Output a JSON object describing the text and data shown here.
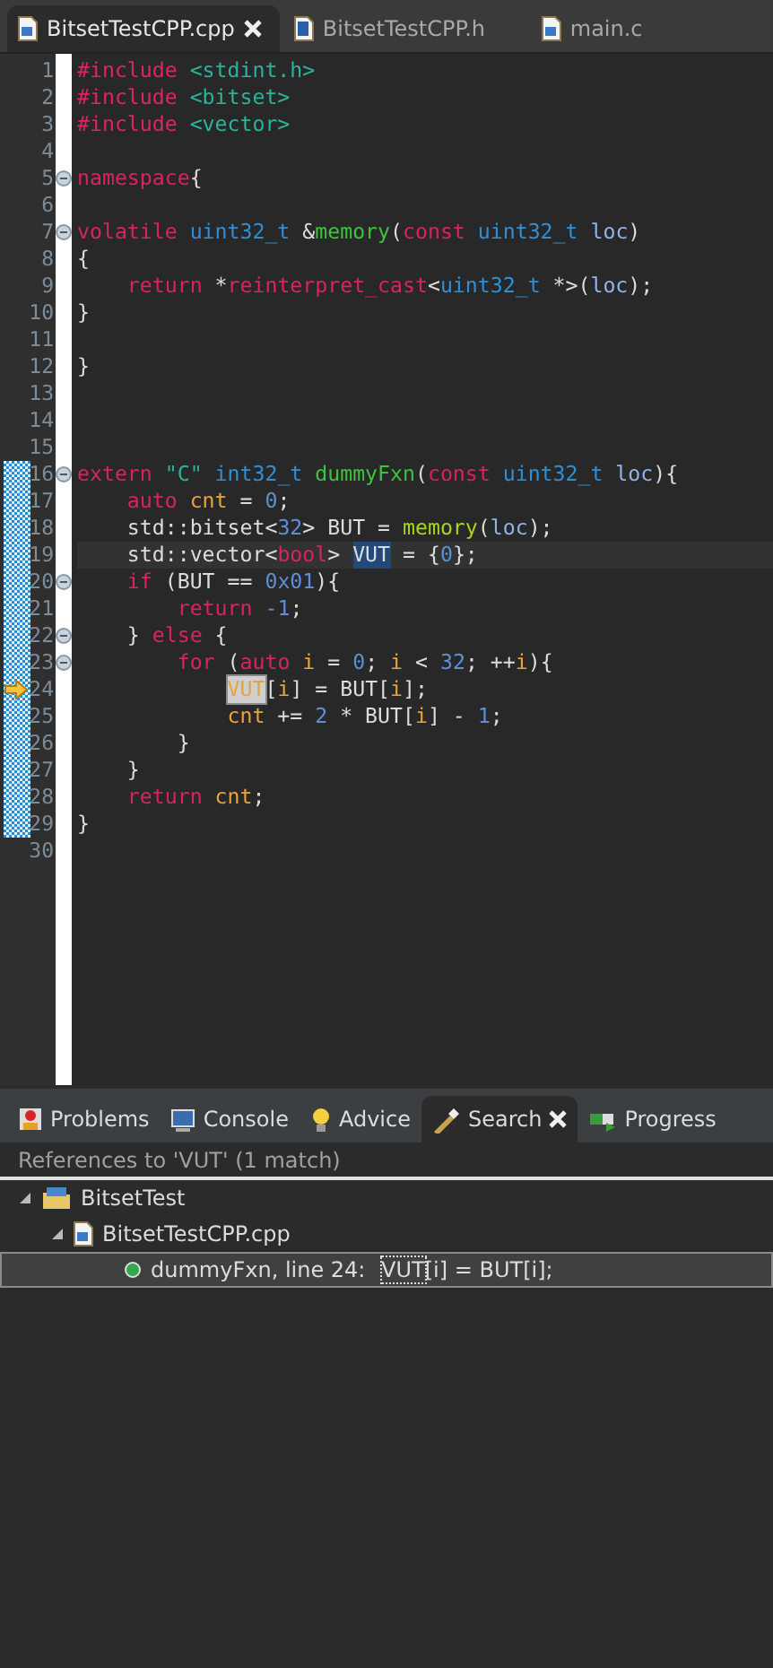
{
  "editor_tabs": [
    {
      "label": "BitsetTestCPP.cpp",
      "selected": true,
      "closable": true
    },
    {
      "label": "BitsetTestCPP.h",
      "selected": false,
      "closable": false
    },
    {
      "label": "main.c",
      "selected": false,
      "closable": false
    }
  ],
  "code_lines": [
    {
      "number": "1",
      "tokens": [
        {
          "text": "#include",
          "kind": "preproc"
        },
        {
          "text": " <stdint.h>",
          "kind": "header"
        }
      ]
    },
    {
      "number": "2",
      "tokens": [
        {
          "text": "#include",
          "kind": "preproc"
        },
        {
          "text": " <bitset>",
          "kind": "header"
        }
      ]
    },
    {
      "number": "3",
      "tokens": [
        {
          "text": "#include",
          "kind": "preproc"
        },
        {
          "text": " <vector>",
          "kind": "header"
        }
      ]
    },
    {
      "number": "4"
    },
    {
      "number": "5",
      "foldable": true,
      "tokens": [
        {
          "text": "namespace",
          "kind": "keyword"
        },
        {
          "text": "{",
          "kind": "plain"
        }
      ]
    },
    {
      "number": "6"
    },
    {
      "number": "7",
      "foldable": true,
      "tokens": [
        {
          "text": "volatile",
          "kind": "keyword"
        },
        {
          "text": " uint32_t",
          "kind": "type"
        },
        {
          "text": " &",
          "kind": "plain"
        },
        {
          "text": "memory",
          "kind": "function"
        },
        {
          "text": "(",
          "kind": "plain"
        },
        {
          "text": "const",
          "kind": "keyword"
        },
        {
          "text": " uint32_t",
          "kind": "type"
        },
        {
          "text": " loc",
          "kind": "param"
        },
        {
          "text": ")",
          "kind": "plain"
        }
      ]
    },
    {
      "number": "8",
      "tokens": [
        {
          "text": "{",
          "kind": "plain"
        }
      ]
    },
    {
      "number": "9",
      "tokens": [
        {
          "text": "    return",
          "kind": "keyword"
        },
        {
          "text": " *",
          "kind": "plain"
        },
        {
          "text": "reinterpret_cast",
          "kind": "keyword"
        },
        {
          "text": "<",
          "kind": "plain"
        },
        {
          "text": "uint32_t",
          "kind": "type"
        },
        {
          "text": " *>(",
          "kind": "plain"
        },
        {
          "text": "loc",
          "kind": "param"
        },
        {
          "text": ");",
          "kind": "plain"
        }
      ]
    },
    {
      "number": "10",
      "tokens": [
        {
          "text": "}",
          "kind": "plain"
        }
      ]
    },
    {
      "number": "11"
    },
    {
      "number": "12",
      "tokens": [
        {
          "text": "}",
          "kind": "plain"
        }
      ]
    },
    {
      "number": "13"
    },
    {
      "number": "14"
    },
    {
      "number": "15"
    },
    {
      "number": "16",
      "foldable": true,
      "changed": true,
      "tokens": [
        {
          "text": "extern",
          "kind": "keyword"
        },
        {
          "text": " \"C\"",
          "kind": "string"
        },
        {
          "text": " int32_t",
          "kind": "type"
        },
        {
          "text": " dummyFxn",
          "kind": "function"
        },
        {
          "text": "(",
          "kind": "plain"
        },
        {
          "text": "const",
          "kind": "keyword"
        },
        {
          "text": " uint32_t",
          "kind": "type"
        },
        {
          "text": " loc",
          "kind": "param"
        },
        {
          "text": "){",
          "kind": "plain"
        }
      ]
    },
    {
      "number": "17",
      "changed": true,
      "tokens": [
        {
          "text": "    auto",
          "kind": "keyword"
        },
        {
          "text": " cnt",
          "kind": "variable"
        },
        {
          "text": " = ",
          "kind": "plain"
        },
        {
          "text": "0",
          "kind": "number"
        },
        {
          "text": ";",
          "kind": "plain"
        }
      ]
    },
    {
      "number": "18",
      "changed": true,
      "tokens": [
        {
          "text": "    std::bitset<",
          "kind": "plain"
        },
        {
          "text": "32",
          "kind": "number"
        },
        {
          "text": "> BUT = ",
          "kind": "plain"
        },
        {
          "text": "memory",
          "kind": "call"
        },
        {
          "text": "(",
          "kind": "plain"
        },
        {
          "text": "loc",
          "kind": "param"
        },
        {
          "text": ");",
          "kind": "plain"
        }
      ]
    },
    {
      "number": "19",
      "changed": true,
      "current": true,
      "tokens": [
        {
          "text": "    std::vector<",
          "kind": "plain"
        },
        {
          "text": "bool",
          "kind": "keyword"
        },
        {
          "text": "> ",
          "kind": "plain"
        },
        {
          "text": "VUT",
          "kind": "plain",
          "selection": true
        },
        {
          "text": " = {",
          "kind": "plain"
        },
        {
          "text": "0",
          "kind": "number"
        },
        {
          "text": "};",
          "kind": "plain"
        }
      ]
    },
    {
      "number": "20",
      "foldable": true,
      "changed": true,
      "tokens": [
        {
          "text": "    if",
          "kind": "keyword"
        },
        {
          "text": " (BUT == ",
          "kind": "plain"
        },
        {
          "text": "0x01",
          "kind": "number"
        },
        {
          "text": "){",
          "kind": "plain"
        }
      ]
    },
    {
      "number": "21",
      "changed": true,
      "tokens": [
        {
          "text": "        return",
          "kind": "keyword"
        },
        {
          "text": " -1",
          "kind": "number"
        },
        {
          "text": ";",
          "kind": "plain"
        }
      ]
    },
    {
      "number": "22",
      "foldable": true,
      "changed": true,
      "tokens": [
        {
          "text": "    } ",
          "kind": "plain"
        },
        {
          "text": "else",
          "kind": "keyword"
        },
        {
          "text": " {",
          "kind": "plain"
        }
      ]
    },
    {
      "number": "23",
      "foldable": true,
      "changed": true,
      "tokens": [
        {
          "text": "        for",
          "kind": "keyword"
        },
        {
          "text": " (",
          "kind": "plain"
        },
        {
          "text": "auto",
          "kind": "keyword"
        },
        {
          "text": " i",
          "kind": "variable"
        },
        {
          "text": " = ",
          "kind": "plain"
        },
        {
          "text": "0",
          "kind": "number"
        },
        {
          "text": "; ",
          "kind": "plain"
        },
        {
          "text": "i",
          "kind": "variable"
        },
        {
          "text": " < ",
          "kind": "plain"
        },
        {
          "text": "32",
          "kind": "number"
        },
        {
          "text": "; ++",
          "kind": "plain"
        },
        {
          "text": "i",
          "kind": "variable"
        },
        {
          "text": "){",
          "kind": "plain"
        }
      ]
    },
    {
      "number": "24",
      "changed": true,
      "debug_arrow": true,
      "tokens": [
        {
          "text": "            VUT",
          "kind": "variable",
          "occurrence": true
        },
        {
          "text": "[",
          "kind": "plain"
        },
        {
          "text": "i",
          "kind": "variable"
        },
        {
          "text": "] = BUT[",
          "kind": "plain"
        },
        {
          "text": "i",
          "kind": "variable"
        },
        {
          "text": "];",
          "kind": "plain"
        }
      ]
    },
    {
      "number": "25",
      "changed": true,
      "tokens": [
        {
          "text": "            cnt",
          "kind": "variable"
        },
        {
          "text": " += ",
          "kind": "plain"
        },
        {
          "text": "2",
          "kind": "number"
        },
        {
          "text": " * BUT[",
          "kind": "plain"
        },
        {
          "text": "i",
          "kind": "variable"
        },
        {
          "text": "] - ",
          "kind": "plain"
        },
        {
          "text": "1",
          "kind": "number"
        },
        {
          "text": ";",
          "kind": "plain"
        }
      ]
    },
    {
      "number": "26",
      "changed": true,
      "tokens": [
        {
          "text": "        }",
          "kind": "plain"
        }
      ]
    },
    {
      "number": "27",
      "changed": true,
      "tokens": [
        {
          "text": "    }",
          "kind": "plain"
        }
      ]
    },
    {
      "number": "28",
      "changed": true,
      "tokens": [
        {
          "text": "    return",
          "kind": "keyword"
        },
        {
          "text": " cnt",
          "kind": "variable"
        },
        {
          "text": ";",
          "kind": "plain"
        }
      ]
    },
    {
      "number": "29",
      "changed": true,
      "tokens": [
        {
          "text": "}",
          "kind": "plain"
        }
      ]
    },
    {
      "number": "30"
    }
  ],
  "panel_tabs": [
    {
      "label": "Problems",
      "selected": false,
      "closable": false
    },
    {
      "label": "Console",
      "selected": false,
      "closable": false
    },
    {
      "label": "Advice",
      "selected": false,
      "closable": false
    },
    {
      "label": "Search",
      "selected": true,
      "closable": true
    },
    {
      "label": "Progress",
      "selected": false,
      "closable": false
    }
  ],
  "search": {
    "header": "References to 'VUT' (1 match)",
    "tree": [
      {
        "kind": "project",
        "label": "BitsetTest",
        "expanded": true,
        "children": [
          {
            "kind": "file",
            "label": "BitsetTestCPP.cpp",
            "expanded": true,
            "children": [
              {
                "kind": "match",
                "label": "dummyFxn, line 24: ",
                "match": "VUT",
                "rest": "[i] = BUT[i];",
                "selected": true
              }
            ]
          }
        ]
      }
    ]
  }
}
